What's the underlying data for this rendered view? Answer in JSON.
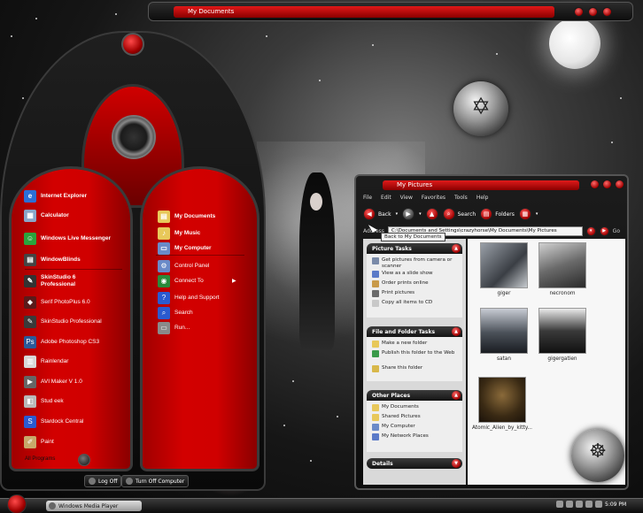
{
  "top_window": {
    "title": "My Documents"
  },
  "start_menu": {
    "left_items": [
      {
        "label": "Internet Explorer",
        "bold": true,
        "icon": "internet-explorer-icon",
        "color": "#2b6fd6",
        "glyph": "e"
      },
      {
        "label": "Calculator",
        "bold": true,
        "icon": "calculator-icon",
        "color": "#8aa6c8",
        "glyph": "▦"
      },
      {
        "label": "Windows Live Messenger",
        "bold": true,
        "icon": "messenger-icon",
        "color": "#2aa43c",
        "glyph": "☺"
      },
      {
        "label": "WindowBlinds",
        "bold": true,
        "icon": "windowblinds-icon",
        "color": "#444444",
        "glyph": "▤"
      },
      {
        "label": "SkinStudio 6 Professional",
        "bold": true,
        "icon": "skinstudio-icon",
        "color": "#333333",
        "glyph": "✎"
      },
      {
        "label": "Serif PhotoPlus 6.0",
        "bold": false,
        "icon": "photoplus-icon",
        "color": "#5a1a1a",
        "glyph": "◆"
      },
      {
        "label": "SkinStudio Professional",
        "bold": false,
        "icon": "skinstudio-pro-icon",
        "color": "#3a3a3a",
        "glyph": "✎"
      },
      {
        "label": "Adobe Photoshop CS3",
        "bold": false,
        "icon": "photoshop-icon",
        "color": "#2a5a9a",
        "glyph": "Ps"
      },
      {
        "label": "Rainlendar",
        "bold": false,
        "icon": "rainlendar-icon",
        "color": "#d8d8d8",
        "glyph": "▥"
      },
      {
        "label": "AVI Maker V 1.0",
        "bold": false,
        "icon": "avi-maker-icon",
        "color": "#666666",
        "glyph": "▶"
      },
      {
        "label": "Stud eek",
        "bold": false,
        "icon": "studeek-icon",
        "color": "#b9b9b9",
        "glyph": "◧"
      },
      {
        "label": "Stardock Central",
        "bold": false,
        "icon": "stardock-central-icon",
        "color": "#2a5ad0",
        "glyph": "S"
      },
      {
        "label": "Paint",
        "bold": false,
        "icon": "paint-icon",
        "color": "#c8a86a",
        "glyph": "✐"
      }
    ],
    "right_items": [
      {
        "label": "My Documents",
        "bold": true,
        "icon": "my-documents-icon",
        "color": "#e8c85a",
        "glyph": "▤"
      },
      {
        "label": "My Music",
        "bold": true,
        "icon": "my-music-icon",
        "color": "#e8c85a",
        "glyph": "♪"
      },
      {
        "label": "My Computer",
        "bold": true,
        "icon": "my-computer-icon",
        "color": "#6a8ac8",
        "glyph": "▭"
      },
      {
        "label": "Control Panel",
        "bold": false,
        "icon": "control-panel-icon",
        "color": "#6a8ac8",
        "glyph": "⚙"
      },
      {
        "label": "Connect To",
        "bold": false,
        "icon": "connect-to-icon",
        "color": "#2a8a3a",
        "glyph": "◉",
        "submenu": true
      },
      {
        "label": "Help and Support",
        "bold": false,
        "icon": "help-icon",
        "color": "#2a5ad0",
        "glyph": "?"
      },
      {
        "label": "Search",
        "bold": false,
        "icon": "search-icon",
        "color": "#2a5ad0",
        "glyph": "⌕"
      },
      {
        "label": "Run...",
        "bold": false,
        "icon": "run-icon",
        "color": "#8a8a8a",
        "glyph": "▭"
      }
    ],
    "all_programs": "All Programs",
    "log_off": "Log Off",
    "turn_off": "Turn Off Computer"
  },
  "explorer": {
    "title": "My Pictures",
    "menu": [
      "File",
      "Edit",
      "View",
      "Favorites",
      "Tools",
      "Help"
    ],
    "toolbar": {
      "back": "Back",
      "search": "Search",
      "folders": "Folders"
    },
    "address_label": "Address",
    "address_value": "C:\\Documents and Settings\\crazyhorse\\My Documents\\My Pictures",
    "go": "Go",
    "tooltip": "Back to My Documents",
    "picture_tasks": {
      "title": "Picture Tasks",
      "items": [
        "Get pictures from camera or scanner",
        "View as a slide show",
        "Order prints online",
        "Print pictures",
        "Copy all items to CD"
      ]
    },
    "file_folder_tasks": {
      "title": "File and Folder Tasks",
      "items": [
        "Make a new folder",
        "Publish this folder to the Web",
        "Share this folder"
      ]
    },
    "other_places": {
      "title": "Other Places",
      "items": [
        "My Documents",
        "Shared Pictures",
        "My Computer",
        "My Network Places"
      ]
    },
    "details": {
      "title": "Details"
    },
    "files": [
      "giger",
      "necronom",
      "satan",
      "gigergatien",
      "Atomic_Alien_by_kitty..."
    ]
  },
  "taskbar": {
    "task": "Windows Media Player",
    "clock": "5:09 PM"
  }
}
